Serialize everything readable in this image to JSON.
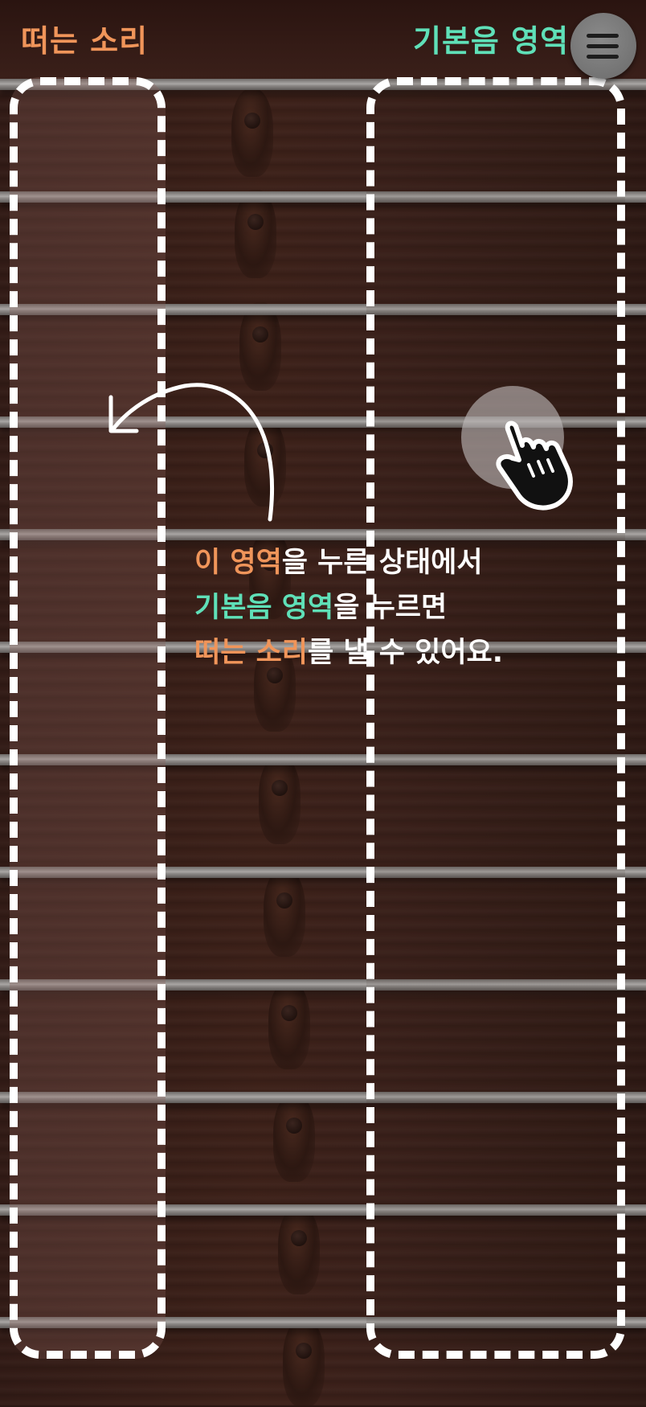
{
  "header": {
    "left_label": "떠는 소리",
    "right_label": "기본음 영역"
  },
  "menu": {
    "icon": "hamburger-menu-icon"
  },
  "instructions": {
    "line1_hl": "이 영역",
    "line1_rest": "을 누른 상태에서",
    "line2_hl": "기본음 영역",
    "line2_rest": "을 누르면",
    "line3_hl": "떠는 소리",
    "line3_rest": "를 낼 수 있어요."
  },
  "colors": {
    "vibrato_accent": "#f0955a",
    "base_accent": "#5fe0b8",
    "wood": "#3a201a",
    "string": "#a9a6a4"
  },
  "icons": {
    "touch": "pointing-hand-icon",
    "arrow": "curved-arrow-icon"
  }
}
